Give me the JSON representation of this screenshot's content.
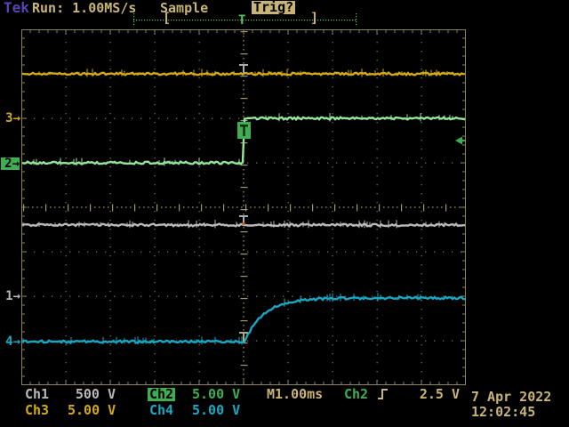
{
  "colors": {
    "tan": "#c8b476",
    "purple": "#5b44b4",
    "ch1": "#b9b9b9",
    "ch2": "#95e69c",
    "ch2_strong": "#3fae53",
    "ch3": "#d2ab14",
    "ch4": "#17a9c4",
    "grid_dot": "#70705f",
    "frame": "#8d835a",
    "center_tick": "#a2986a",
    "record_line": "#4ec463",
    "t_tick": "#b3a87a",
    "t_tick_gray": "#ababab",
    "orange_mark": "#d06020"
  },
  "top_bar": {
    "logo": "Tek",
    "run_status": "Run: 1.00MS/s",
    "acquisition_mode": "Sample",
    "trigger_status": "Trig?"
  },
  "record_view": {
    "left_bracket": "[",
    "right_bracket": "]",
    "trigger_marker": "T"
  },
  "channel_markers": {
    "ch3": "3→",
    "ch2": "2→",
    "ch1": "1→",
    "ch4": "4→"
  },
  "trigger_point_label": "T",
  "readouts": {
    "ch1": {
      "label": "Ch1",
      "value": "500 V"
    },
    "ch2": {
      "label": "Ch2",
      "value": "5.00 V"
    },
    "ch3": {
      "label": "Ch3",
      "value": "5.00 V"
    },
    "ch4": {
      "label": "Ch4",
      "value": "5.00 V"
    },
    "timebase": "M1.00ms",
    "trigger_source": "Ch2",
    "trigger_level": "2.5 V",
    "date": "7 Apr 2022",
    "time": "12:02:45"
  },
  "icons": {
    "trigger_slope": "rising-edge"
  },
  "chart_data": {
    "type": "line",
    "title": "Oscilloscope graticule 10x8 divisions, dotted grid, center crosshair ticks",
    "x_axis": {
      "label": "time",
      "divisions": 10,
      "time_per_div": "1.00 ms",
      "sample_rate": "1.00 MS/s"
    },
    "y_axis": {
      "divisions": 8
    },
    "trigger": {
      "source": "Ch2",
      "level_div": 1.5,
      "level_volts": "2.5 V",
      "position_div": 0.0,
      "slope": "rising"
    },
    "series": [
      {
        "name": "Ch3",
        "color_key": "ch3",
        "volts_per_div": "5.00 V",
        "shape": "flat",
        "level_div": 3.0,
        "ground_marker_div": 2.0
      },
      {
        "name": "Ch1",
        "color_key": "ch1",
        "volts_per_div": "500 V",
        "shape": "flat",
        "level_div": -0.4,
        "ground_marker_div": -2.0
      },
      {
        "name": "Ch2",
        "color_key": "ch2",
        "volts_per_div": "5.00 V",
        "shape": "step",
        "low_div": 1.0,
        "high_div": 2.0,
        "step_at_div": 0.0,
        "ground_marker_div": 1.0,
        "selected": true
      },
      {
        "name": "Ch4",
        "color_key": "ch4",
        "volts_per_div": "5.00 V",
        "shape": "exp_rise",
        "low_div": -3.02,
        "high_div": -2.04,
        "start_div": 0.0,
        "tau_div": 0.44,
        "ground_marker_div": -3.02
      }
    ]
  }
}
